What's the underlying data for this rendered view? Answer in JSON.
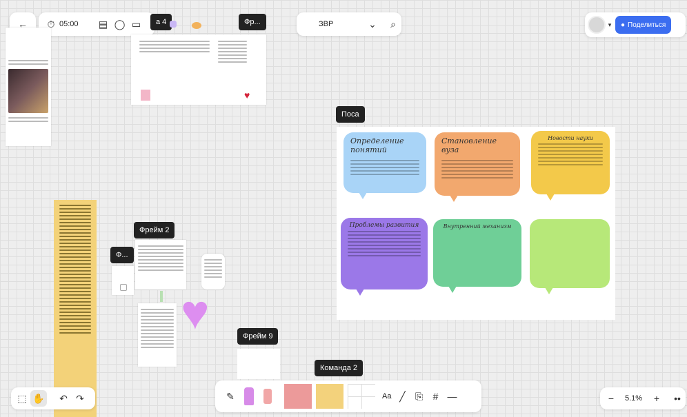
{
  "topbar": {
    "timer": "05:00",
    "board_name": "ЗВР",
    "share_label": "Поделиться"
  },
  "frames": {
    "frame_a": "а 4",
    "frame_b": "Фр...",
    "frame_main": "Поса",
    "frame_2": "Фрейм 2",
    "frame_small": "Ф...",
    "frame_9": "Фрейм 9",
    "team_2": "Команда 2"
  },
  "bubbles": [
    {
      "title": "Определение понятий",
      "color": "#a9d4f7"
    },
    {
      "title": "Становление вуза",
      "color": "#f2a86e"
    },
    {
      "title": "Новости науки",
      "color": "#f3c94a"
    },
    {
      "title": "Проблемы развития",
      "color": "#9b78e8"
    },
    {
      "title": "Внутренний механизм",
      "color": "#6fcf97"
    },
    {
      "title": "",
      "color": "#b7e879"
    }
  ],
  "toolbar_bottom": {
    "text_tool": "Aa"
  },
  "zoom": {
    "value": "5.1%"
  },
  "icons": {
    "back": "arrow-left-icon",
    "timer": "stopwatch-icon",
    "search": "search-icon",
    "chevron": "chevron-down-icon",
    "heart": "heart-icon"
  }
}
